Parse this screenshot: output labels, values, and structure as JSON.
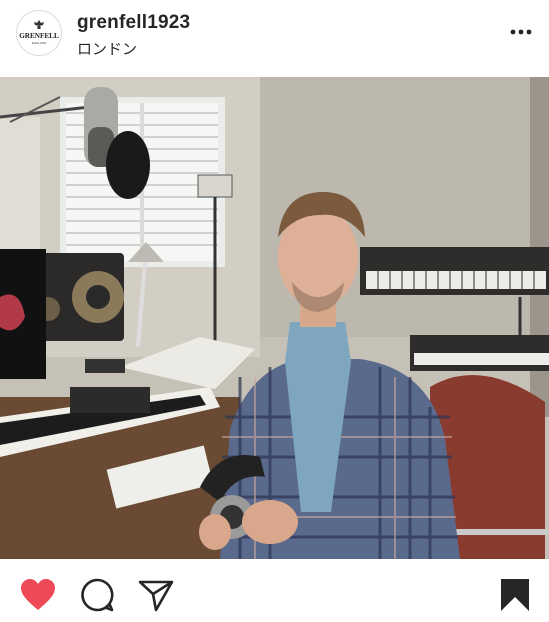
{
  "post": {
    "username": "grenfell1923",
    "location": "ロンドン",
    "logo_text": "GRENFELL",
    "logo_subtext": "ENGLAND",
    "image_description_icon": "photo",
    "liked": true
  },
  "icons": {
    "more": "more-horizontal-icon",
    "tag": "user-tag-icon",
    "like": "heart-filled-icon",
    "comment": "comment-icon",
    "share": "send-icon",
    "save": "bookmark-filled-icon"
  },
  "colors": {
    "like": "#ed4956",
    "text": "#262626"
  }
}
